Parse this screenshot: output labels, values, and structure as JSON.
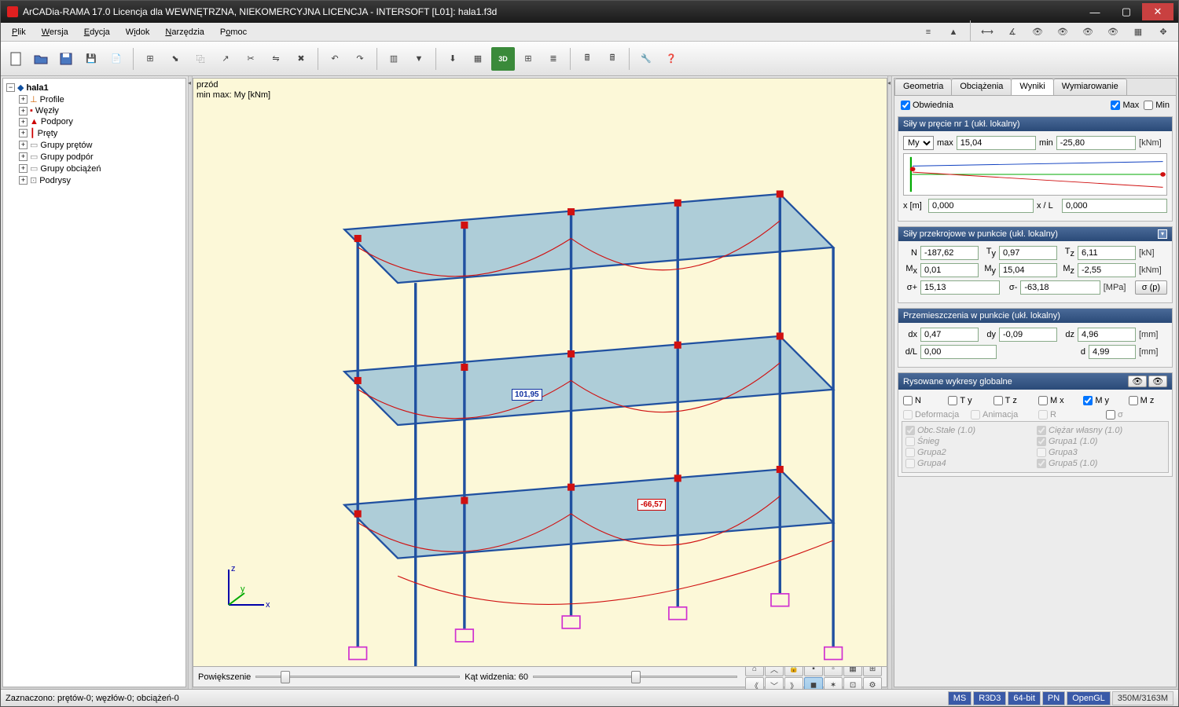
{
  "window": {
    "title": "ArCADia-RAMA 17.0 Licencja dla WEWNĘTRZNA, NIEKOMERCYJNA LICENCJA - INTERSOFT [L01]: hala1.f3d"
  },
  "menu": {
    "plik": "Plik",
    "wersja": "Wersja",
    "edycja": "Edycja",
    "widok": "Widok",
    "narzedzia": "Narzędzia",
    "pomoc": "Pomoc"
  },
  "tree": {
    "root": "hala1",
    "items": [
      "Profile",
      "Węzły",
      "Podpory",
      "Pręty",
      "Grupy prętów",
      "Grupy podpór",
      "Grupy obciążeń",
      "Podrysy"
    ]
  },
  "view": {
    "head1": "przód",
    "head2": "min max: My [kNm]",
    "ann1": "101,95",
    "ann2": "-66,57",
    "zoom_label": "Powiększenie",
    "fov_label": "Kąt widzenia: 60"
  },
  "tabs": {
    "geo": "Geometria",
    "obc": "Obciążenia",
    "wyn": "Wyniki",
    "wym": "Wymiarowanie"
  },
  "top": {
    "obw": "Obwiednia",
    "max": "Max",
    "min": "Min"
  },
  "s1": {
    "title": "Siły w pręcie nr 1 (ukł. lokalny)",
    "sel": "My",
    "max_l": "max",
    "max_v": "15,04",
    "min_l": "min",
    "min_v": "-25,80",
    "unit": "[kNm]",
    "xl": "x [m]",
    "xv": "0,000",
    "xLl": "x / L",
    "xLv": "0,000"
  },
  "s2": {
    "title": "Siły przekrojowe w punkcie (ukł. lokalny)",
    "N": "-187,62",
    "Ty": "0,97",
    "Tz": "6,11",
    "u1": "[kN]",
    "Mx": "0,01",
    "My": "15,04",
    "Mz": "-2,55",
    "u2": "[kNm]",
    "sp": "15,13",
    "sm": "-63,18",
    "u3": "[MPa]",
    "btn": "σ (p)"
  },
  "s3": {
    "title": "Przemieszczenia w punkcie (ukł. lokalny)",
    "dx": "0,47",
    "dy": "-0,09",
    "dz": "4,96",
    "u1": "[mm]",
    "dL": "0,00",
    "d": "4,99",
    "u2": "[mm]"
  },
  "s4": {
    "title": "Rysowane wykresy globalne",
    "opts": [
      "N",
      "Ty",
      "Tz",
      "Mx",
      "My",
      "Mz"
    ],
    "opts2": [
      "Deformacja",
      "Animacja",
      "R",
      "σ"
    ],
    "loads": [
      [
        "Obc.Stałe (1.0)",
        "Ciężar własny (1.0)"
      ],
      [
        "Śnieg",
        "Grupa1 (1.0)"
      ],
      [
        "Grupa2",
        "Grupa3"
      ],
      [
        "Grupa4",
        "Grupa5 (1.0)"
      ]
    ]
  },
  "status": {
    "left": "Zaznaczono: prętów-0; węzłów-0; obciążeń-0",
    "segs": [
      "MS",
      "R3D3",
      "64-bit",
      "PN",
      "OpenGL"
    ],
    "mem": "350M/3163M"
  }
}
